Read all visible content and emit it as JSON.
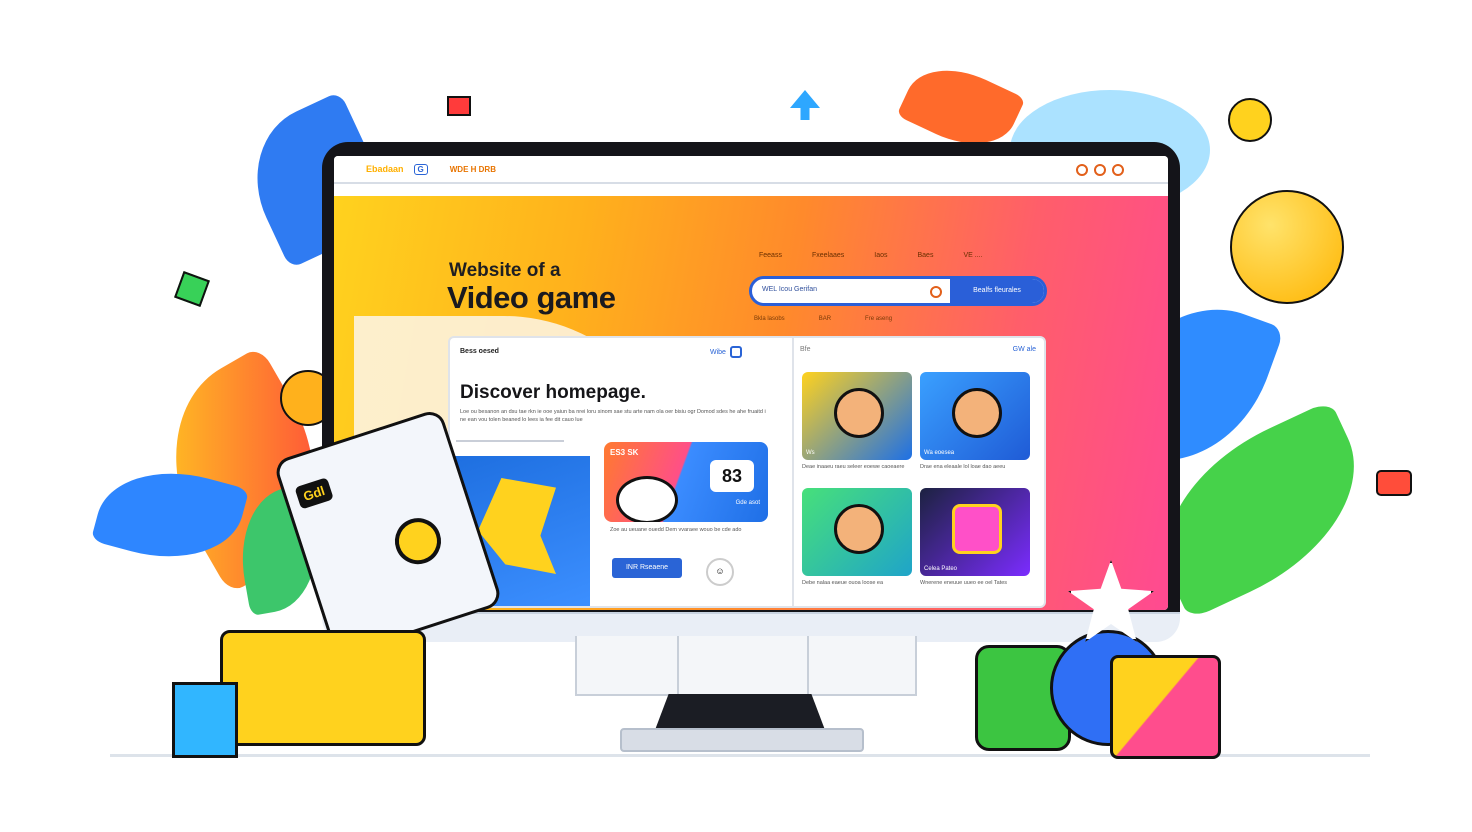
{
  "browser": {
    "brand": "Ebadaan",
    "tab_icon": "G",
    "menu": "WDE  H DRB"
  },
  "hero": {
    "title_line1": "Website of a",
    "title_line2": "Video game",
    "nav": [
      "Feeass",
      "Fxeelaaes",
      "Iaos",
      "Baes",
      "VE ...."
    ],
    "search_placeholder": "WEL Icou Gerifan",
    "search_button": "Bealfs fleurales",
    "links": [
      "Bkla lasobs",
      "BAR",
      "Fre aseng"
    ]
  },
  "panel": {
    "header": "Bess oesed",
    "mini_label": "Wibe",
    "title": "Discover homepage.",
    "description": "Loe ou besanon an dsu tae rkn ie ooe yaiun ba nrei loru sinom sae stu arte nam ola oer bisiu ogr Domod sdes he ahe fruaitd i ne ean vou tolen beaned lo lees ia fee dit cauo lue",
    "promo_label": "ES3 SK",
    "promo_badge": "83",
    "promo_tag": "Gde asot",
    "promo_text": "Zoe au ueuane ouedd  Dem vvaraee wouo be cde ado",
    "cta_label": "INR Rseaene",
    "right_header": "Bfe",
    "right_option": "GW ale"
  },
  "tiles": [
    {
      "name": "Ws",
      "caption": "Deae inaaeu raeu seleer eoewe caoeaere"
    },
    {
      "name": "Wa eoesea",
      "caption": "Drae ena eleaale lol loae dao  aeeu"
    },
    {
      "name": "",
      "caption": "Debe nalaa eaeue ouoa loose ea"
    },
    {
      "name": "Celea Pateo",
      "caption": "Wnerene eneuue uueo ee oel Tates"
    }
  ],
  "device_card": {
    "label": "Gdl"
  }
}
